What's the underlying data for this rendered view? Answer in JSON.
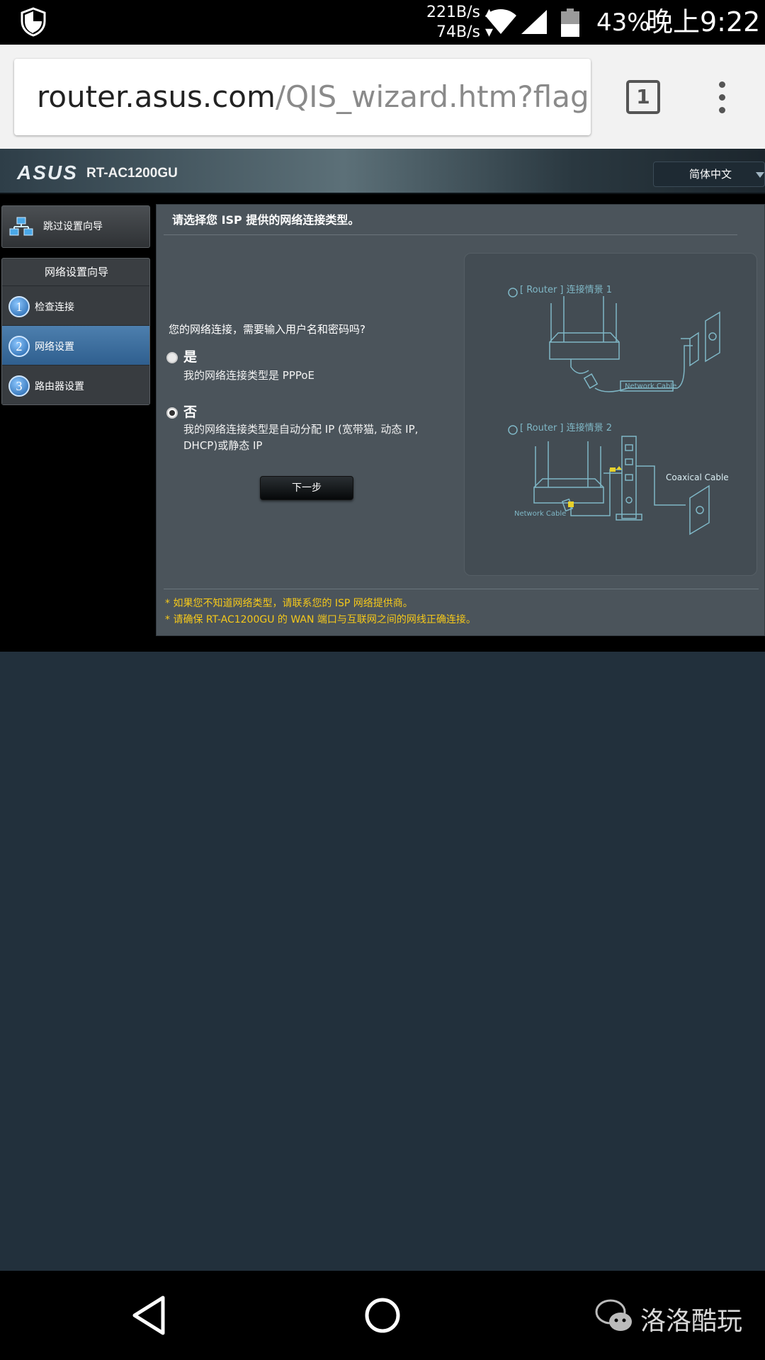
{
  "status_bar": {
    "upload_speed": "221B/s ▴",
    "download_speed": "74B/s ▾",
    "battery_percent": "43%",
    "time": "晚上9:22"
  },
  "browser": {
    "url_host": "router.asus.com",
    "url_path": "/QIS_wizard.htm?flag=w",
    "tab_count": "1"
  },
  "router": {
    "brand": "ASUS",
    "model": "RT-AC1200GU",
    "language": "简体中文"
  },
  "sidebar": {
    "skip_label": "跳过设置向导",
    "wizard_title": "网络设置向导",
    "steps": [
      {
        "num": "1",
        "label": "检查连接"
      },
      {
        "num": "2",
        "label": "网络设置"
      },
      {
        "num": "3",
        "label": "路由器设置"
      }
    ]
  },
  "main": {
    "title": "请选择您 ISP 提供的网络连接类型。",
    "question": "您的网络连接，需要输入用户名和密码吗?",
    "option_yes": {
      "label": "是",
      "desc": "我的网络连接类型是 PPPoE"
    },
    "option_no": {
      "label": "否",
      "desc": "我的网络连接类型是自动分配 IP (宽带猫, 动态 IP, DHCP)或静态 IP"
    },
    "selected_option": "否",
    "next_button": "下一步"
  },
  "diagram": {
    "scenario1_label": "[ Router ] 连接情景 1",
    "scenario2_label": "[ Router ] 连接情景 2",
    "network_cable": "Network Cable",
    "coaxial_cable": "Coaxical Cable"
  },
  "notes": [
    "* 如果您不知道网络类型，请联系您的 ISP 网络提供商。",
    "* 请确保 RT-AC1200GU 的 WAN 端口与互联网之间的网线正确连接。"
  ],
  "watermark": "洛洛酷玩"
}
